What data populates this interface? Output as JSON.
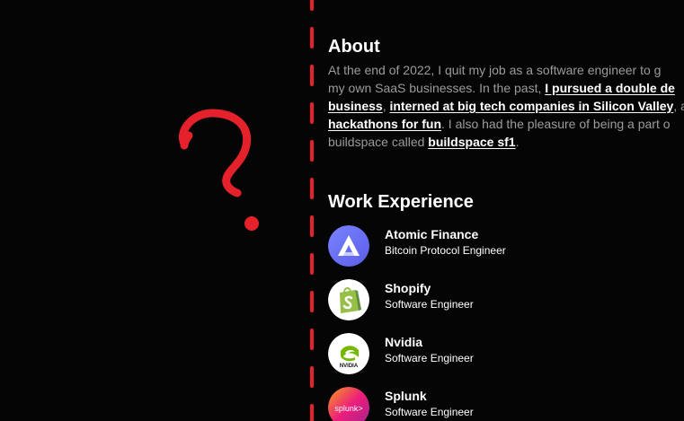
{
  "about": {
    "title": "About",
    "lines": [
      [
        {
          "text": "At the end of 2022, I quit my job as a software engineer to g",
          "link": false
        }
      ],
      [
        {
          "text": "my own SaaS businesses. In the past, ",
          "link": false
        },
        {
          "text": "I pursued a double de",
          "link": true
        }
      ],
      [
        {
          "text": "business",
          "link": true
        },
        {
          "text": ", ",
          "link": false
        },
        {
          "text": "interned at big tech companies in Silicon Valley",
          "link": true
        },
        {
          "text": ", a",
          "link": false
        }
      ],
      [
        {
          "text": "hackathons for fun",
          "link": true
        },
        {
          "text": ". I also had the pleasure of being a part o",
          "link": false
        }
      ],
      [
        {
          "text": "buildspace called ",
          "link": false
        },
        {
          "text": "buildspace sf1",
          "link": true
        },
        {
          "text": ".",
          "link": false
        }
      ]
    ]
  },
  "work": {
    "title": "Work Experience",
    "jobs": [
      {
        "company": "Atomic Finance",
        "role": "Bitcoin Protocol Engineer",
        "logo": "atomic-finance-logo-icon"
      },
      {
        "company": "Shopify",
        "role": "Software Engineer",
        "logo": "shopify-logo-icon"
      },
      {
        "company": "Nvidia",
        "role": "Software Engineer",
        "logo": "nvidia-logo-icon",
        "logo_text": "NVIDIA"
      },
      {
        "company": "Splunk",
        "role": "Software Engineer",
        "logo": "splunk-logo-icon",
        "logo_text": "splunk>"
      }
    ]
  },
  "colors": {
    "background": "#050505",
    "accent_red": "#e5222b",
    "muted_text": "#9b9b9b"
  }
}
